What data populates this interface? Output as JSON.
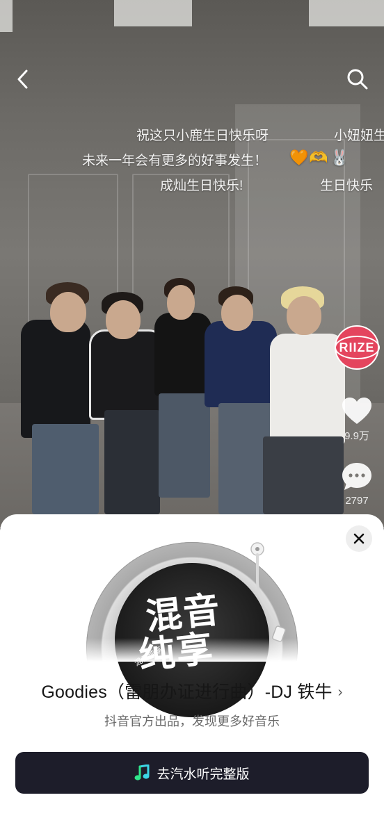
{
  "danmaku": [
    "祝这只小鹿生日快乐呀",
    "小妞妞生",
    "未来一年会有更多的好事发生！",
    "🧡",
    "🫶",
    "🐰",
    "成灿生日快乐!",
    "生日快乐"
  ],
  "rail": {
    "avatar_text": "RIIZE",
    "like_count": "9.9万",
    "comment_count": "2797"
  },
  "sheet": {
    "song_title": "Goodies（雷朋办证进行曲）-DJ 铁牛",
    "subtitle": "抖音官方出品，发现更多好音乐",
    "cta_label": "去汽水听完整版",
    "album_text_1": "混音",
    "album_text_2": "纯享",
    "album_small": "混音纯享"
  },
  "colors": {
    "cta_bg": "#1d1d2a",
    "avatar_bg": "#e4455e",
    "music_icon_green": "#2fe68a",
    "music_icon_cyan": "#3cd6e6"
  },
  "icons": [
    "back-icon",
    "search-icon",
    "heart-icon",
    "comment-icon",
    "close-icon",
    "chevron-right-icon",
    "music-note-icon"
  ]
}
